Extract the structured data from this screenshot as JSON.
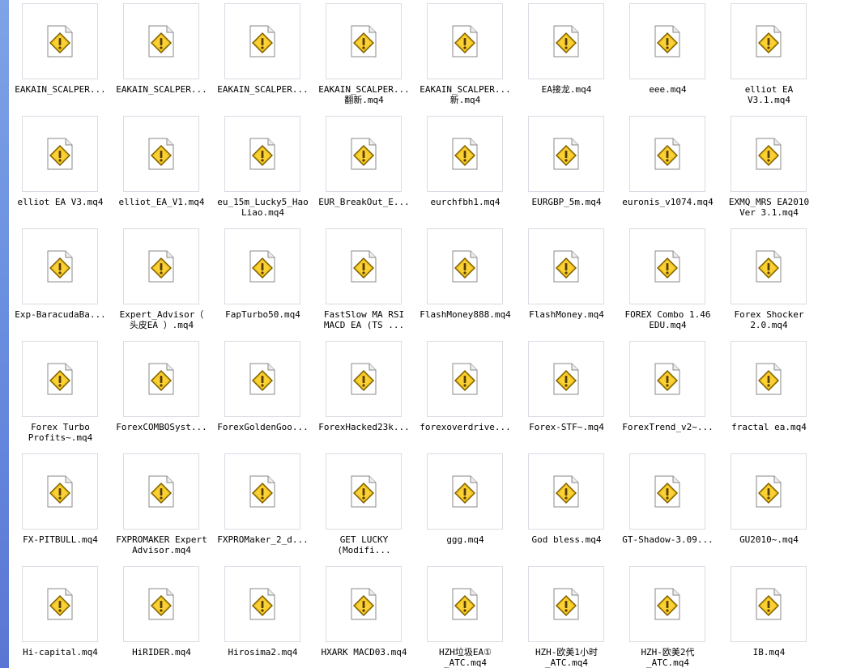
{
  "files": [
    {
      "label": "EAKAIN_SCALPER..."
    },
    {
      "label": "EAKAIN_SCALPER..."
    },
    {
      "label": "EAKAIN_SCALPER..."
    },
    {
      "label": "EAKAIN_SCALPER...\n翻新.mq4"
    },
    {
      "label": "EAKAIN_SCALPER...\n新.mq4"
    },
    {
      "label": "EA接龙.mq4"
    },
    {
      "label": "eee.mq4"
    },
    {
      "label": "elliot EA\nV3.1.mq4"
    },
    {
      "label": "elliot EA V3.mq4"
    },
    {
      "label": "elliot_EA_V1.mq4"
    },
    {
      "label": "eu_15m_Lucky5_Hao\nLiao.mq4"
    },
    {
      "label": "EUR_BreakOut_E..."
    },
    {
      "label": "eurchfbh1.mq4"
    },
    {
      "label": "EURGBP_5m.mq4"
    },
    {
      "label": "euronis_v1074.mq4"
    },
    {
      "label": "EXMQ_MRS EA2010\nVer 3.1.mq4"
    },
    {
      "label": "Exp-BaracudaBa..."
    },
    {
      "label": "Expert_Advisor（\n头皮EA ）.mq4"
    },
    {
      "label": "FapTurbo50.mq4"
    },
    {
      "label": "FastSlow MA RSI\nMACD EA (TS ..."
    },
    {
      "label": "FlashMoney888.mq4"
    },
    {
      "label": "FlashMoney.mq4"
    },
    {
      "label": "FOREX Combo 1.46\nEDU.mq4"
    },
    {
      "label": "Forex Shocker\n2.0.mq4"
    },
    {
      "label": "Forex Turbo\nProfits~.mq4"
    },
    {
      "label": "ForexCOMBOSyst..."
    },
    {
      "label": "ForexGoldenGoo..."
    },
    {
      "label": "ForexHacked23k..."
    },
    {
      "label": "forexoverdrive..."
    },
    {
      "label": "Forex-STF~.mq4"
    },
    {
      "label": "ForexTrend_v2~..."
    },
    {
      "label": "fractal ea.mq4"
    },
    {
      "label": "FX-PITBULL.mq4"
    },
    {
      "label": "FXPROMAKER Expert\nAdvisor.mq4"
    },
    {
      "label": "FXPROMaker_2_d..."
    },
    {
      "label": "GET LUCKY\n(Modifi..."
    },
    {
      "label": "ggg.mq4"
    },
    {
      "label": "God bless.mq4"
    },
    {
      "label": "GT-Shadow-3.09..."
    },
    {
      "label": "GU2010~.mq4"
    },
    {
      "label": "Hi-capital.mq4"
    },
    {
      "label": "HiRIDER.mq4"
    },
    {
      "label": "Hirosima2.mq4"
    },
    {
      "label": "HXARK MACD03.mq4"
    },
    {
      "label": "HZH垃圾EA①\n_ATC.mq4"
    },
    {
      "label": "HZH-欧美1小时\n_ATC.mq4"
    },
    {
      "label": "HZH-欧美2代\n_ATC.mq4"
    },
    {
      "label": "IB.mq4"
    }
  ],
  "icons": {
    "file": "unknown-file-warning-icon",
    "accent_yellow": "#f3c51a",
    "accent_dark": "#6b4b00"
  }
}
